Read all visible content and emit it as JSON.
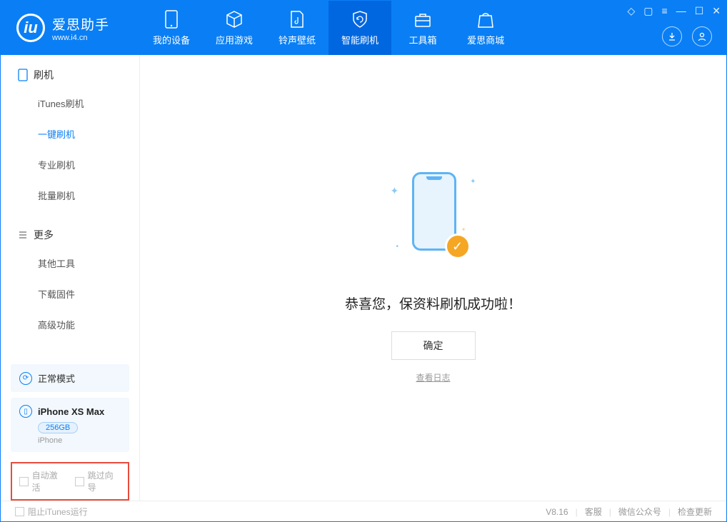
{
  "app": {
    "title": "爱思助手",
    "site": "www.i4.cn"
  },
  "tabs": [
    {
      "label": "我的设备"
    },
    {
      "label": "应用游戏"
    },
    {
      "label": "铃声壁纸"
    },
    {
      "label": "智能刷机"
    },
    {
      "label": "工具箱"
    },
    {
      "label": "爱思商城"
    }
  ],
  "sidebar": {
    "section1": {
      "title": "刷机",
      "items": [
        "iTunes刷机",
        "一键刷机",
        "专业刷机",
        "批量刷机"
      ]
    },
    "section2": {
      "title": "更多",
      "items": [
        "其他工具",
        "下载固件",
        "高级功能"
      ]
    }
  },
  "device": {
    "mode": "正常模式",
    "name": "iPhone XS Max",
    "capacity": "256GB",
    "type": "iPhone"
  },
  "options": {
    "auto_activate": "自动激活",
    "skip_wizard": "跳过向导"
  },
  "main": {
    "success": "恭喜您，保资料刷机成功啦！",
    "confirm": "确定",
    "view_log": "查看日志"
  },
  "footer": {
    "block_itunes": "阻止iTunes运行",
    "version": "V8.16",
    "service": "客服",
    "wechat": "微信公众号",
    "update": "检查更新"
  }
}
